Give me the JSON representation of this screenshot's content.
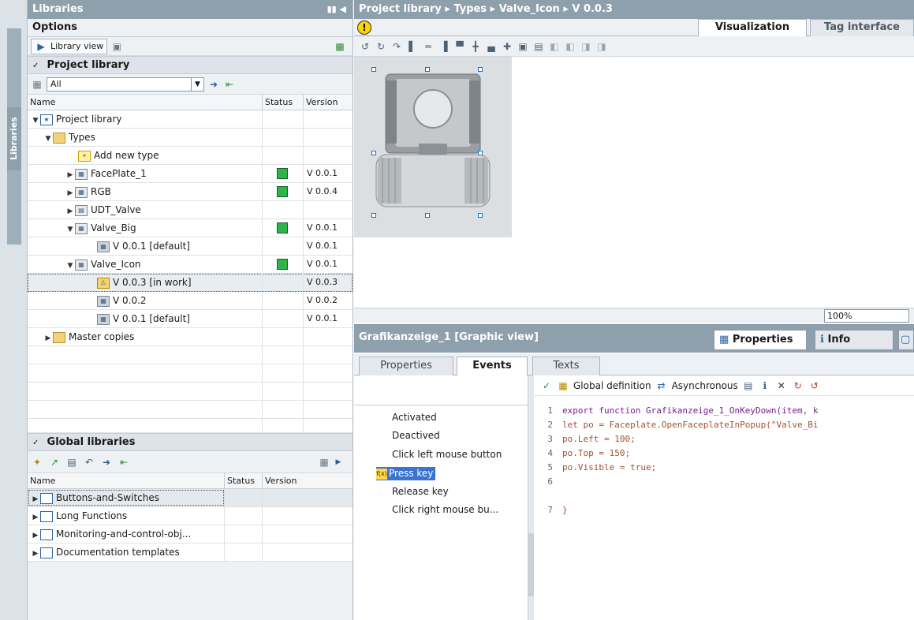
{
  "vertical_tab": "Libraries",
  "left": {
    "title": "Libraries",
    "options_label": "Options",
    "library_view_label": "Library view",
    "project_library": {
      "header": "Project library",
      "filter_value": "All",
      "columns": [
        "Name",
        "Status",
        "Version"
      ],
      "rows": [
        {
          "name": "Project library",
          "status": false,
          "version": ""
        },
        {
          "name": "Types",
          "status": false,
          "version": ""
        },
        {
          "name": "Add new type",
          "status": false,
          "version": ""
        },
        {
          "name": "FacePlate_1",
          "status": true,
          "version": "V 0.0.1"
        },
        {
          "name": "RGB",
          "status": true,
          "version": "V 0.0.4"
        },
        {
          "name": "UDT_Valve",
          "status": false,
          "version": ""
        },
        {
          "name": "Valve_Big",
          "status": true,
          "version": "V 0.0.1"
        },
        {
          "name": "V 0.0.1 [default]",
          "status": false,
          "version": "V 0.0.1"
        },
        {
          "name": "Valve_Icon",
          "status": true,
          "version": "V 0.0.1"
        },
        {
          "name": "V 0.0.3 [in work]",
          "status": false,
          "version": "V 0.0.3"
        },
        {
          "name": "V 0.0.2",
          "status": false,
          "version": "V 0.0.2"
        },
        {
          "name": "V 0.0.1 [default]",
          "status": false,
          "version": "V 0.0.1"
        },
        {
          "name": "Master copies",
          "status": false,
          "version": ""
        }
      ]
    },
    "global_libraries": {
      "header": "Global libraries",
      "columns": [
        "Name",
        "Status",
        "Version"
      ],
      "rows": [
        {
          "name": "Buttons-and-Switches"
        },
        {
          "name": "Long Functions"
        },
        {
          "name": "Monitoring-and-control-obj..."
        },
        {
          "name": "Documentation templates"
        }
      ]
    }
  },
  "right": {
    "breadcrumb": "Project library  ▸  Types  ▸  Valve_Icon  ▸  V 0.0.3",
    "tabs": [
      "Visualization",
      "Tag interface"
    ],
    "zoom": "100%",
    "inspector": {
      "title": "Grafikanzeige_1 [Graphic view]",
      "tabs": [
        "Properties",
        "Info"
      ],
      "subtabs": [
        "Properties",
        "Events",
        "Texts"
      ],
      "events": [
        "Activated",
        "Deactived",
        "Click left mouse button",
        "Press key",
        "Release key",
        "Click right mouse bu..."
      ],
      "selected_event": "Press key",
      "toolbar": {
        "global_definition": "Global definition",
        "asynchronous": "Asynchronous"
      },
      "code": [
        {
          "n": "1",
          "text": "export function Grafikanzeige_1_OnKeyDown(item, k"
        },
        {
          "n": "2",
          "text": "let po = Faceplate.OpenFaceplateInPopup(\"Valve_Bi"
        },
        {
          "n": "3",
          "text": "po.Left = 100;"
        },
        {
          "n": "4",
          "text": "po.Top = 150;"
        },
        {
          "n": "5",
          "text": "po.Visible = true;"
        },
        {
          "n": "6",
          "text": ""
        },
        {
          "n": "7",
          "text": "}"
        }
      ]
    }
  }
}
